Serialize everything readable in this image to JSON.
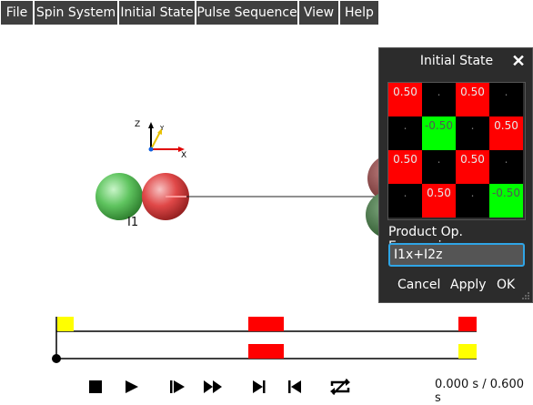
{
  "menu": {
    "items": [
      {
        "label": "File"
      },
      {
        "label": "Spin System"
      },
      {
        "label": "Initial State"
      },
      {
        "label": "Pulse Sequence"
      },
      {
        "label": "View"
      },
      {
        "label": "Help"
      }
    ]
  },
  "scene": {
    "axes": {
      "z": "Z",
      "y": "Y",
      "x": "X"
    },
    "spin_label": "I1"
  },
  "dialog": {
    "title": "Initial State",
    "close_icon": "close-icon",
    "matrix": [
      [
        "0.50",
        ".",
        "0.50",
        "."
      ],
      [
        ".",
        "-0.50",
        ".",
        "0.50"
      ],
      [
        "0.50",
        ".",
        "0.50",
        "."
      ],
      [
        ".",
        "0.50",
        ".",
        "-0.50"
      ]
    ],
    "matrix_colors": [
      [
        "red",
        "black",
        "red",
        "black"
      ],
      [
        "black",
        "green",
        "black",
        "red"
      ],
      [
        "red",
        "black",
        "red",
        "black"
      ],
      [
        "black",
        "red",
        "black",
        "green"
      ]
    ],
    "expression_label": "Product Op. Expression:",
    "expression_value": "I1x+I2z",
    "cancel_label": "Cancel",
    "apply_label": "Apply",
    "ok_label": "OK"
  },
  "controls": {
    "icons": [
      "stop-icon",
      "play-icon",
      "step-forward-icon",
      "fast-forward-icon",
      "skip-to-end-icon",
      "skip-to-start-icon",
      "loop-icon"
    ],
    "time_readout": "0.000 s / 0.600 s"
  },
  "colors": {
    "menu_bg": "#3f3f3f",
    "dialog_bg": "#2c2c2c",
    "accent": "#2fa5e6",
    "pulse_red": "#ff0000",
    "pulse_yellow": "#ffff00"
  }
}
